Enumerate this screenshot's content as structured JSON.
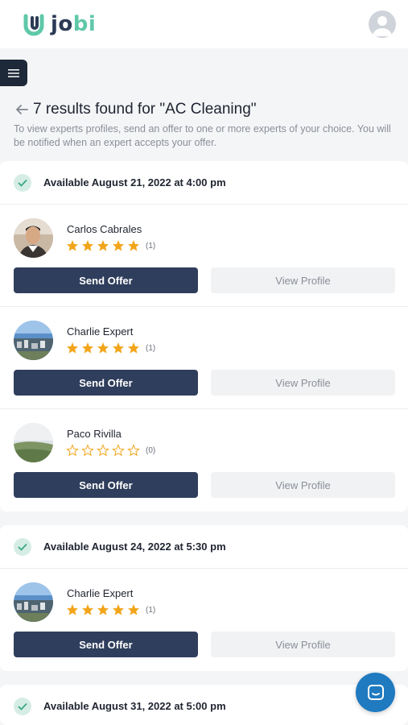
{
  "brand": {
    "logo_text_dark": "jo",
    "logo_text_accent": "bi",
    "accent_color": "#5fc8a8",
    "primary_color": "#2f3e5c"
  },
  "header": {
    "title": "7 results found for \"AC Cleaning\"",
    "subtitle": "To view experts profiles, send an offer to one or more experts of your choice. You will be notified when an expert accepts your offer."
  },
  "labels": {
    "send_offer": "Send Offer",
    "view_profile": "View Profile"
  },
  "groups": [
    {
      "availability": "Available August 21, 2022 at 4:00 pm",
      "experts": [
        {
          "name": "Carlos Cabrales",
          "rating": 5,
          "reviews": "(1)",
          "avatar": "person-photo"
        },
        {
          "name": "Charlie Expert",
          "rating": 5,
          "reviews": "(1)",
          "avatar": "city-photo"
        },
        {
          "name": "Paco Rivilla",
          "rating": 0,
          "reviews": "(0)",
          "avatar": "landscape-photo"
        }
      ]
    },
    {
      "availability": "Available August 24, 2022 at 5:30 pm",
      "experts": [
        {
          "name": "Charlie Expert",
          "rating": 5,
          "reviews": "(1)",
          "avatar": "city-photo"
        }
      ]
    },
    {
      "availability": "Available August 31, 2022 at 5:00 pm",
      "experts": []
    }
  ],
  "icons": {
    "menu": "hamburger-icon",
    "back": "arrow-left-icon",
    "check": "check-icon",
    "star_filled": "star-filled-icon",
    "star_empty": "star-outline-icon",
    "chat": "chat-icon",
    "user": "user-avatar-icon"
  }
}
